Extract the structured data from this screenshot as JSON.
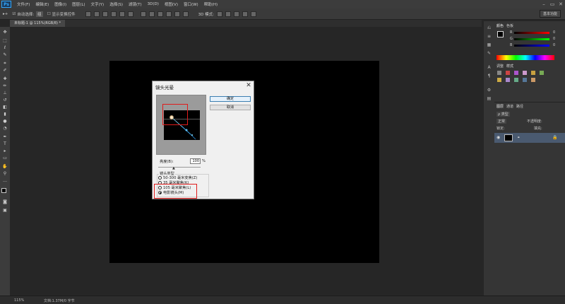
{
  "app": {
    "logo": "Ps"
  },
  "menu": [
    "文件(F)",
    "编辑(E)",
    "图像(I)",
    "图层(L)",
    "文字(Y)",
    "选择(S)",
    "滤镜(T)",
    "3D(D)",
    "视图(V)",
    "窗口(W)",
    "帮助(H)"
  ],
  "window_controls": {
    "minimize": "–",
    "restore": "▭",
    "close": "✕"
  },
  "options": {
    "auto_select_label": "自动选择:",
    "auto_select_value": "组",
    "show_transform_label": "显示变换控件",
    "mode_3d_label": "3D 模式:"
  },
  "workspace": "基本功能",
  "document_tab": "未标题-1 @ 115%(RGB/8) *",
  "dialog": {
    "title": "镜头光晕",
    "close": "✕",
    "ok": "确定",
    "cancel": "取消",
    "brightness_label": "亮度(B):",
    "brightness_value": "100",
    "brightness_unit": "%",
    "lens_type_label": "镜头类型",
    "options": [
      "50-300 毫米变焦(Z)",
      "35 毫米聚焦(K)",
      "105 毫米聚焦(L)",
      "电影镜头(M)"
    ],
    "selected_option": 3
  },
  "panels": {
    "color_tab": "颜色",
    "swatches_tab": "色板",
    "rgb_labels": [
      "R",
      "G",
      "B"
    ],
    "rgb_values": [
      "0",
      "0",
      "0"
    ],
    "adjust_tab": "调整",
    "styles_tab": "样式",
    "layers_tab": "图层",
    "channels_tab": "通道",
    "paths_tab": "路径",
    "kind_label": "ρ 类型",
    "blend_mode": "正常",
    "opacity_label": "不透明度:",
    "lock_label": "锁定:",
    "fill_label": "填充:"
  },
  "status": {
    "zoom": "115%",
    "doc_info": "文档:1.37M/0 字节"
  },
  "colors": {
    "flare_red_box": "#e01b1b",
    "brand": "#31a8ff"
  }
}
